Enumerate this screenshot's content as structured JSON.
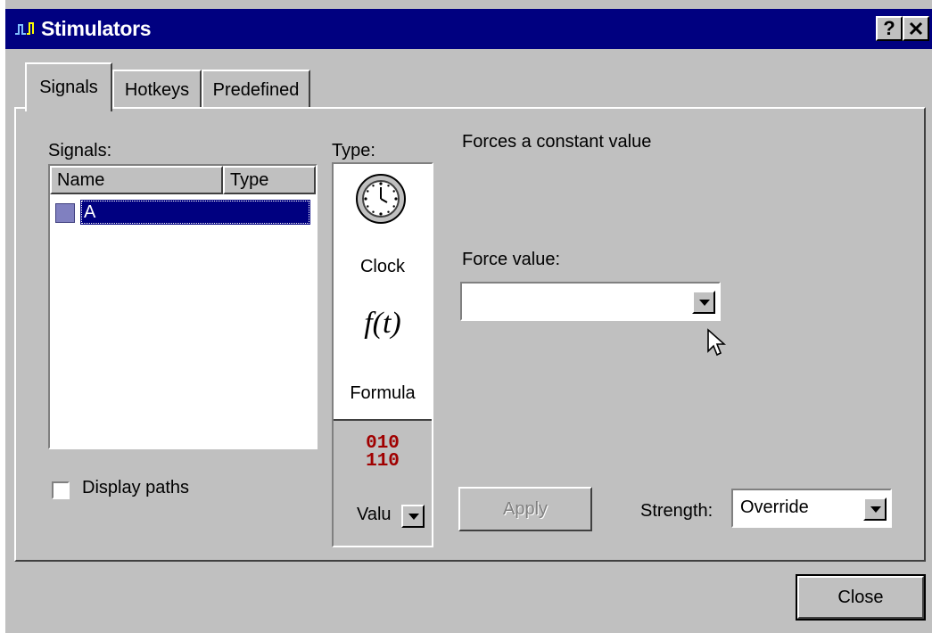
{
  "window": {
    "title": "Stimulators",
    "help_label": "?",
    "close_label": "✕"
  },
  "tabs": [
    {
      "label": "Signals",
      "active": true
    },
    {
      "label": "Hotkeys",
      "active": false
    },
    {
      "label": "Predefined",
      "active": false
    }
  ],
  "signals": {
    "label": "Signals:",
    "columns": [
      "Name",
      "Type"
    ],
    "rows": [
      {
        "name": "A",
        "type": "",
        "selected": true
      }
    ]
  },
  "display_paths": {
    "label": "Display paths",
    "checked": false
  },
  "type_panel": {
    "label": "Type:",
    "options": [
      {
        "label": "Clock",
        "icon": "clock-icon"
      },
      {
        "label": "Formula",
        "icon_text": "f(t)",
        "icon": "formula-icon"
      },
      {
        "label": "Valu",
        "icon_text_top": "010",
        "icon_text_bottom": "110",
        "icon": "binary-value-icon",
        "selected": true
      }
    ]
  },
  "description": "Forces a constant value",
  "force_value": {
    "label": "Force value:",
    "value": ""
  },
  "apply_label": "Apply",
  "strength": {
    "label": "Strength:",
    "value": "Override"
  },
  "close_button_label": "Close",
  "colors": {
    "titlebar": "#000080",
    "face": "#c0c0c0",
    "selection": "#000080"
  }
}
